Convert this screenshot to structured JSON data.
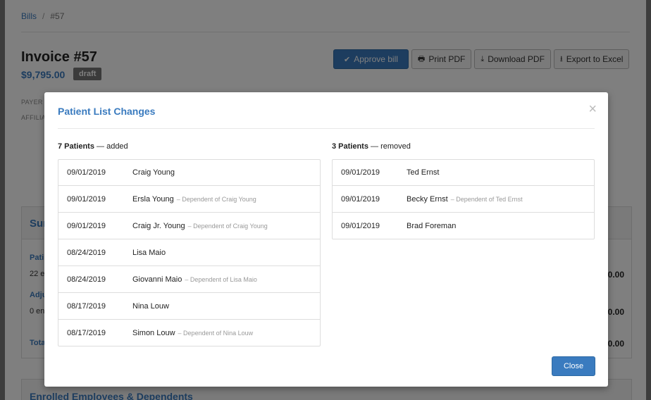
{
  "breadcrumb": {
    "parent": "Bills",
    "separator": "/",
    "current": "#57"
  },
  "invoice": {
    "title": "Invoice #57",
    "amount": "$9,795.00",
    "status": "draft"
  },
  "toolbar": {
    "approve_label": "Approve bill",
    "print_label": "Print PDF",
    "download_label": "Download PDF",
    "export_label": "Export to Excel"
  },
  "meta": {
    "payer_label": "PAYER",
    "affiliate_label": "AFFILIA"
  },
  "summary": {
    "title_fragment": "Sur",
    "patients_label": "Pati",
    "patients_sub": "22 e",
    "adjustments_label": "Adju",
    "adjustments_sub": "0 en",
    "total_label": "Tota",
    "amount_1": "0.00",
    "amount_2": "0.00",
    "amount_3": "0.00"
  },
  "enrolled": {
    "title": "Enrolled Employees & Dependents"
  },
  "modal": {
    "title": "Patient List Changes",
    "close_label": "Close",
    "added": {
      "count_label": "7 Patients",
      "suffix": " — added",
      "rows": [
        {
          "date": "09/01/2019",
          "name": "Craig Young",
          "dependent": ""
        },
        {
          "date": "09/01/2019",
          "name": "Ersla Young",
          "dependent": "– Dependent of Craig Young"
        },
        {
          "date": "09/01/2019",
          "name": "Craig Jr. Young",
          "dependent": "– Dependent of Craig Young"
        },
        {
          "date": "08/24/2019",
          "name": "Lisa Maio",
          "dependent": ""
        },
        {
          "date": "08/24/2019",
          "name": "Giovanni Maio",
          "dependent": "– Dependent of Lisa Maio"
        },
        {
          "date": "08/17/2019",
          "name": "Nina Louw",
          "dependent": ""
        },
        {
          "date": "08/17/2019",
          "name": "Simon Louw",
          "dependent": "– Dependent of Nina Louw"
        }
      ]
    },
    "removed": {
      "count_label": "3 Patients",
      "suffix": " — removed",
      "rows": [
        {
          "date": "09/01/2019",
          "name": "Ted Ernst",
          "dependent": ""
        },
        {
          "date": "09/01/2019",
          "name": "Becky Ernst",
          "dependent": "– Dependent of Ted Ernst"
        },
        {
          "date": "09/01/2019",
          "name": "Brad Foreman",
          "dependent": ""
        }
      ]
    }
  }
}
